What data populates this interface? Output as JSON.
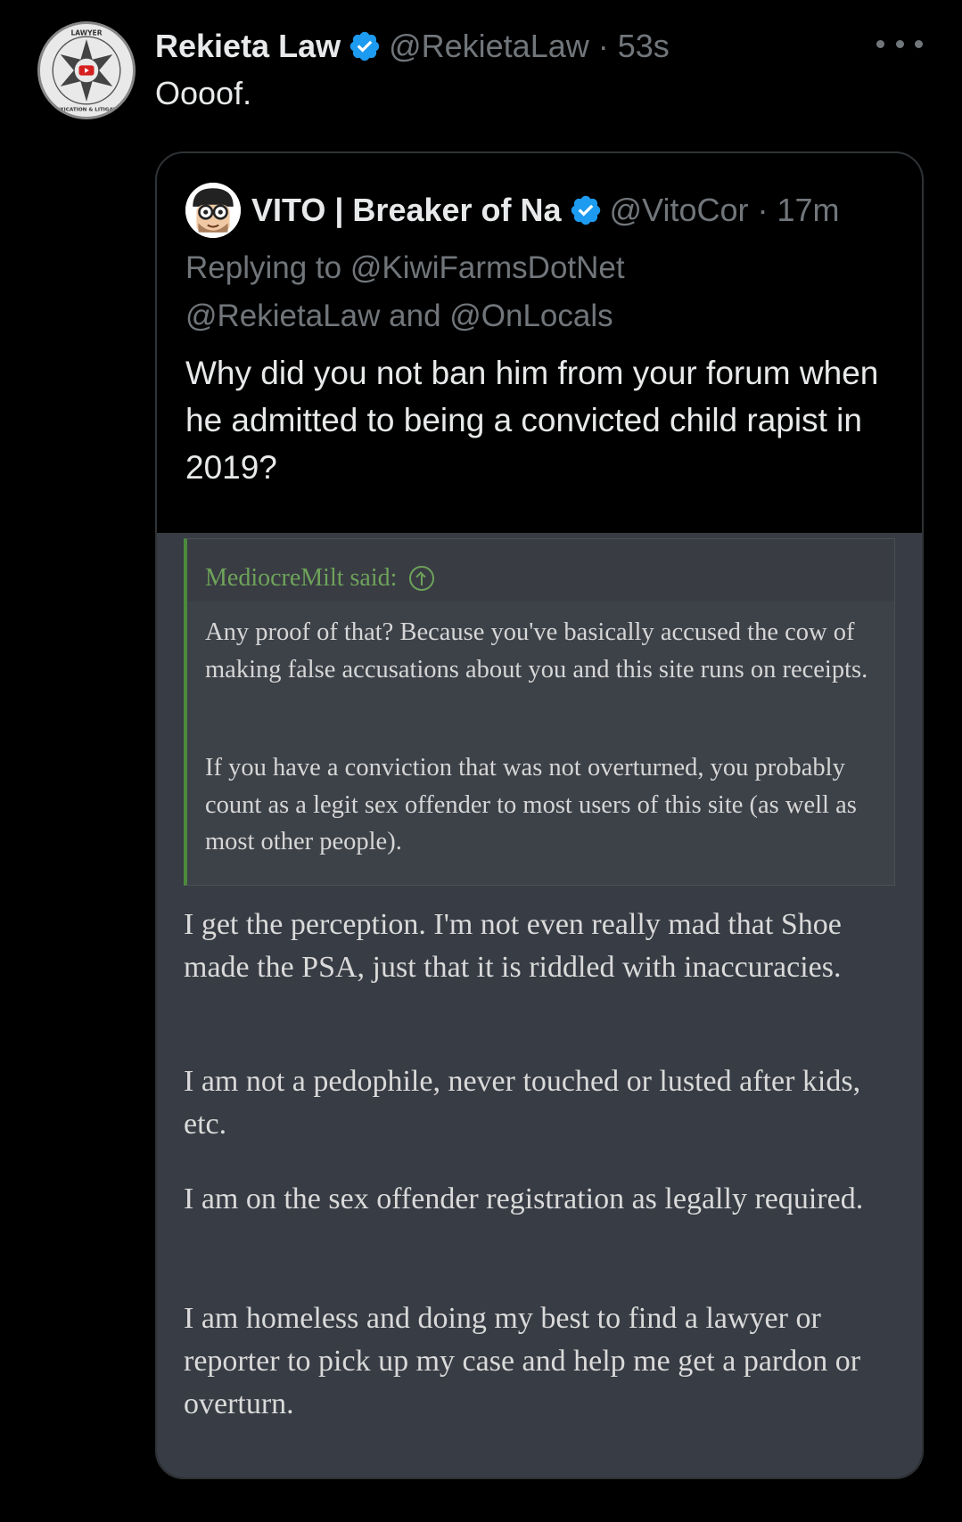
{
  "tweet": {
    "author_name": "Rekieta Law",
    "handle": "@RekietaLaw",
    "separator": "·",
    "time": "53s",
    "text": "Oooof.",
    "avatar_text_top": "LAWYER",
    "avatar_text_left": "YOUTUBE",
    "avatar_text_bottom": "INTOXICATION & LITIGATION"
  },
  "quote": {
    "author_name": "VITO | Breaker of Na",
    "handle": "@VitoCor",
    "separator": "·",
    "time": "17m",
    "reply_line1": "Replying to @KiwiFarmsDotNet",
    "reply_line2": "@RekietaLaw and @OnLocals",
    "text": "Why did you not ban him from your forum when he admitted to being a convicted child rapist in 2019?"
  },
  "forum": {
    "quote_author": "MediocreMilt said:",
    "quote_p1": "Any proof of that? Because you've basically accused the cow of making false accusations about you and this site runs on receipts.",
    "quote_p2": "If you have a conviction that was not overturned, you probably count as a legit sex offender to most users of this site (as well as most other people).",
    "p1": "I get the perception. I'm not even really mad that Shoe made the PSA, just that it is riddled with inaccuracies.",
    "p2": "I am not a pedophile, never touched or lusted after kids, etc.",
    "p3": "I am on the sex offender registration as legally required.",
    "p4": "I am homeless and doing my best to find a lawyer or reporter to pick up my case and help me get a pardon or overturn."
  },
  "colors": {
    "background": "#000000",
    "text_primary": "#e7e9ea",
    "text_secondary": "#71767b",
    "verified_blue": "#1d9bf0",
    "forum_bg": "#383c44",
    "forum_quote_accent": "#4c8a3c"
  },
  "icons": {
    "verified": "verified-badge-icon",
    "more": "more-horizontal-icon",
    "quote_jump": "arrow-up-circle-icon"
  }
}
